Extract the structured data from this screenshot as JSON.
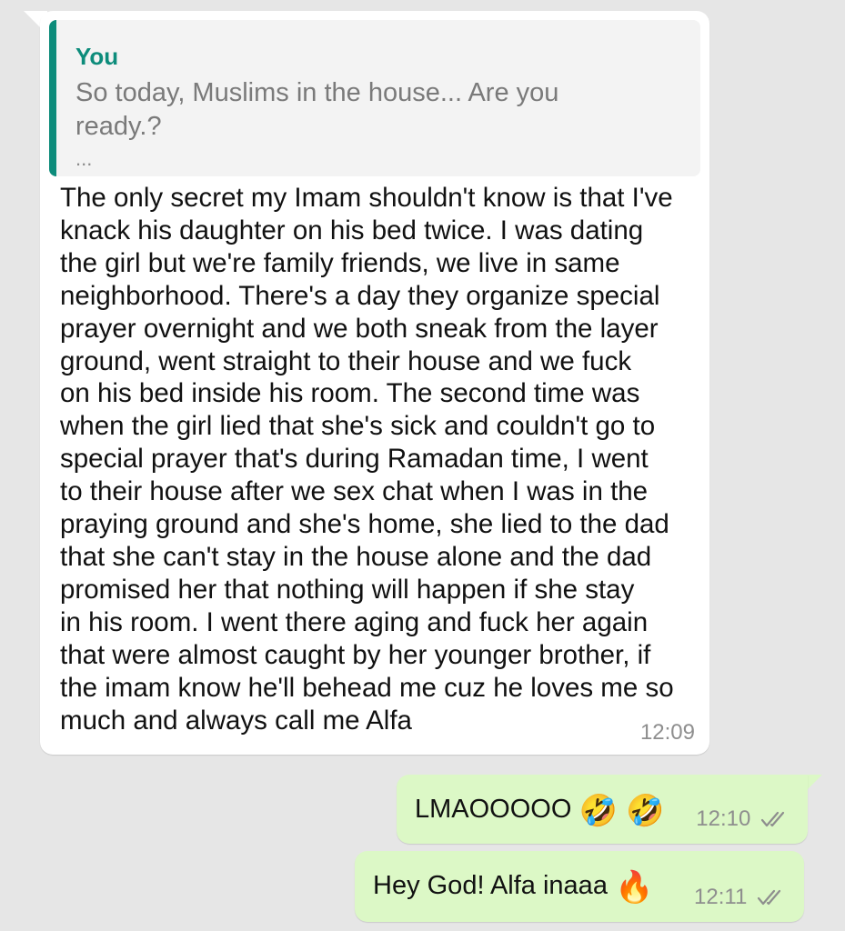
{
  "incoming_message": {
    "quoted": {
      "author": "You",
      "text": "So today, Muslims in the house... Are you ready.?",
      "ellipsis": "..."
    },
    "lines": [
      "The only secret my Imam shouldn't know is that I've",
      "knack his daughter on his bed twice. I was dating",
      "the girl but we're family friends, we live in same",
      "neighborhood. There's a day they organize special",
      "prayer overnight and we both sneak from the layer",
      "ground, went straight to their house and we fuck",
      "on his bed inside his room. The second time was",
      "when the girl lied that she's sick and couldn't go to",
      "special prayer that's during Ramadan time, I went",
      "to their house after we sex chat when I was in the",
      "praying ground and she's home, she lied to the dad",
      "that she can't stay in the house alone and the dad",
      "promised her that nothing will happen if she stay",
      "in his room. I went there aging and fuck her again",
      "that were almost caught by her younger brother, if",
      "the imam know he'll behead me cuz he loves me so",
      "much and always call me Alfa"
    ],
    "time": "12:09"
  },
  "outgoing_messages": [
    {
      "text": "LMAOOOOO",
      "emoji": "🤣 🤣",
      "time": "12:10",
      "status_icon": "double-check-icon"
    },
    {
      "text": "Hey God! Alfa inaaa",
      "emoji": "🔥",
      "time": "12:11",
      "status_icon": "double-check-icon"
    }
  ],
  "colors": {
    "background": "#e6e6e6",
    "incoming_bubble": "#ffffff",
    "outgoing_bubble": "#dcf8c6",
    "quote_accent": "#0d8c7b",
    "timestamp": "#8e8e8e"
  }
}
